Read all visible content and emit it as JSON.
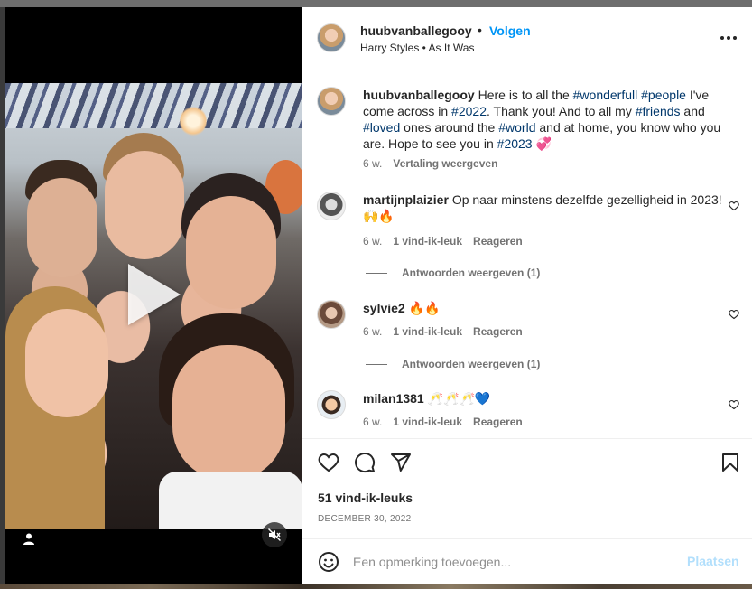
{
  "post": {
    "username": "huubvanballegooy",
    "separator": "•",
    "follow_label": "Volgen",
    "audio": "Harry Styles • As It Was"
  },
  "caption": {
    "username": "huubvanballegooy",
    "segments": [
      {
        "text": "Here is to all the ",
        "tag": false
      },
      {
        "text": "#wonderfull",
        "tag": true
      },
      {
        "text": " ",
        "tag": false
      },
      {
        "text": "#people",
        "tag": true
      },
      {
        "text": " I've come across in ",
        "tag": false
      },
      {
        "text": "#2022",
        "tag": true
      },
      {
        "text": ". Thank you! And to all my ",
        "tag": false
      },
      {
        "text": "#friends",
        "tag": true
      },
      {
        "text": " and ",
        "tag": false
      },
      {
        "text": "#loved",
        "tag": true
      },
      {
        "text": " ones around the ",
        "tag": false
      },
      {
        "text": "#world",
        "tag": true
      },
      {
        "text": " and at home, you know who you are. Hope to see you in ",
        "tag": false
      },
      {
        "text": "#2023",
        "tag": true
      },
      {
        "text": " 💞",
        "tag": false
      }
    ],
    "age": "6 w.",
    "translate_label": "Vertaling weergeven"
  },
  "comments": [
    {
      "username": "martijnplaizier",
      "text": "Op naar minstens dezelfde gezelligheid in 2023! 🙌🔥",
      "age": "6 w.",
      "likes": "1 vind-ik-leuk",
      "reply_label": "Reageren",
      "view_replies": "Antwoorden weergeven (1)"
    },
    {
      "username": "sylvie2",
      "text": "🔥🔥",
      "age": "6 w.",
      "likes": "1 vind-ik-leuk",
      "reply_label": "Reageren",
      "view_replies": "Antwoorden weergeven (1)"
    },
    {
      "username": "milan1381",
      "text": "🥂🥂🥂💙",
      "age": "6 w.",
      "likes": "1 vind-ik-leuk",
      "reply_label": "Reageren"
    }
  ],
  "stats": {
    "likes": "51 vind-ik-leuks",
    "date": "DECEMBER 30, 2022"
  },
  "composer": {
    "placeholder": "Een opmerking toevoegen...",
    "post_label": "Plaatsen"
  },
  "icons": {
    "more": "more-options-icon",
    "like": "heart-icon",
    "comment": "comment-icon",
    "share": "share-icon",
    "save": "bookmark-icon",
    "emoji": "emoji-icon",
    "play": "play-icon",
    "mute": "muted-speaker-icon",
    "tags": "user-tag-icon"
  },
  "colors": {
    "link_blue": "#0095f6",
    "hashtag": "#00376b",
    "muted_text": "#737373",
    "post_disabled": "#b2dffc"
  }
}
